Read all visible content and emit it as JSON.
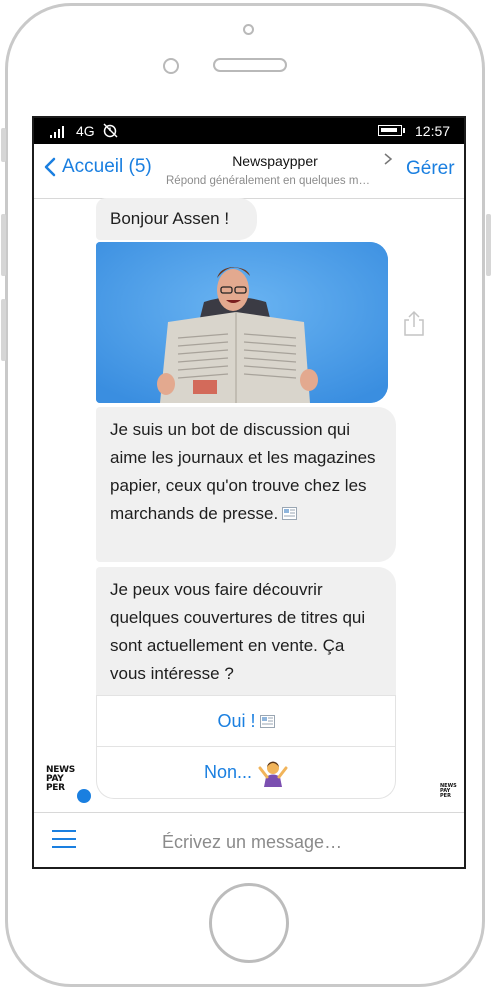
{
  "status_bar": {
    "network": "4G",
    "time": "12:57"
  },
  "header": {
    "back_label": "Accueil (5)",
    "title": "Newspaypper",
    "subtitle": "Répond généralement en quelques m…",
    "manage_label": "Gérer"
  },
  "messages": {
    "greeting": "Bonjour Assen !",
    "intro": "Je suis un bot de discussion qui aime les journaux et les magazines papier, ceux qu'on trouve chez les marchands de presse.",
    "offer": "Je peux vous faire découvrir quelques couvertures de titres qui sont actuellement en vente. Ça vous intéresse ?"
  },
  "quick_replies": {
    "yes": "Oui !",
    "no": "Non..."
  },
  "bot_logo": {
    "line1": "NEWS",
    "line2": "PAY",
    "line3": "PER"
  },
  "composer": {
    "placeholder": "Écrivez un message…"
  },
  "icons": {
    "accent_color": "#1a7fe0",
    "bubble_color": "#f0f0f0"
  }
}
